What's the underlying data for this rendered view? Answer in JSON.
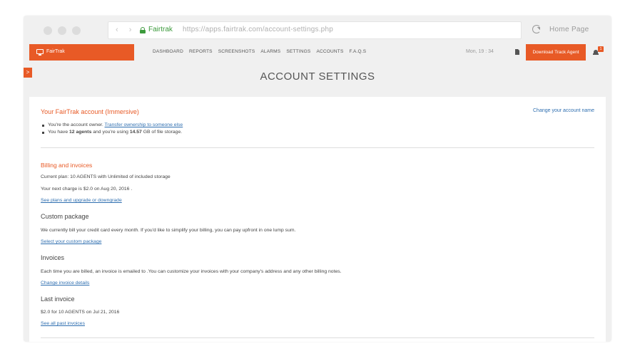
{
  "browser": {
    "nav_arrows": "‹ ›",
    "site_name": "Fairtrak",
    "url": "https://apps.fairtrak.com/account-settings.php",
    "home_label": "Home Page"
  },
  "appbar": {
    "brand": "FairTrak",
    "menu": [
      "DASHBOARD",
      "REPORTS",
      "SCREENSHOTS",
      "ALARMS",
      "SETTINGS",
      "ACCOUNTS",
      "F.A.Q.S"
    ],
    "clock": "Mon, 19 : 34",
    "download_label": "Download Track Agent",
    "notification_count": "1"
  },
  "side_toggle": ">",
  "page_title": "ACCOUNT SETTINGS",
  "account": {
    "title": "Your FairTrak account (Immersive)",
    "change_name_link": "Change your account name",
    "owner_text": "You're the account owner.",
    "transfer_link": "Transfer ownership to someone else",
    "usage_prefix": "You have",
    "agents": "12 agents",
    "usage_mid": "and you're using",
    "storage": "14.57",
    "usage_suffix": "GB of file storage."
  },
  "billing": {
    "title": "Billing and invoices",
    "current_plan": "Current plan: 10 AGENTS with Unlimited of included storage",
    "next_charge": "Your next charge is $2.0 on Aug 20, 2016 .",
    "plans_link": "See plans and upgrade or downgrade"
  },
  "custom_package": {
    "title": "Custom package",
    "text": "We currently bill your credit card every month. If you'd like to simplify your billing, you can pay upfront in one lump sum.",
    "link": "Select your custom package"
  },
  "invoices": {
    "title": "Invoices",
    "text": "Each time you are billed, an invoice is emailed to .You can customize your invoices with your company's address and any other billing notes.",
    "link": "Change invoice details"
  },
  "last_invoice": {
    "title": "Last invoice",
    "text": "$2.0 for 10 AGENTS on Jul 21, 2016",
    "link": "See all past invoices"
  },
  "colors": {
    "accent": "#e85a26",
    "link": "#2f6fb0",
    "secure": "#3c9a3c"
  }
}
